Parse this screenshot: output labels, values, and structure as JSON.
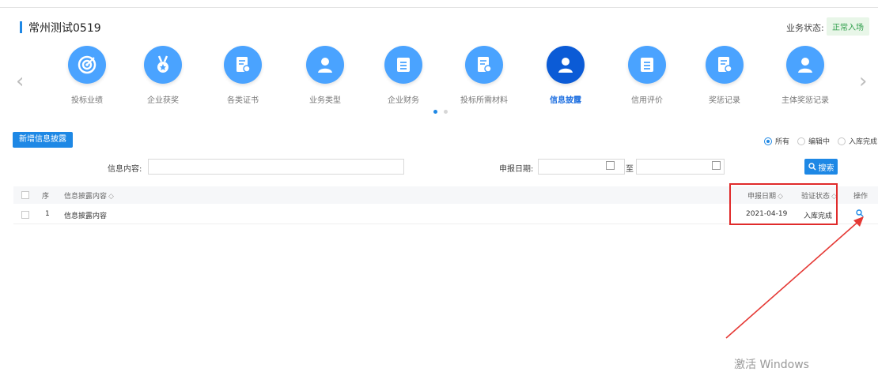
{
  "header": {
    "title": "常州测试0519",
    "status_label": "业务状态:",
    "status_value": "正常入场"
  },
  "carousel": {
    "items": [
      {
        "label": "投标业绩",
        "icon": "target-icon"
      },
      {
        "label": "企业获奖",
        "icon": "medal-icon"
      },
      {
        "label": "各类证书",
        "icon": "certificate-icon"
      },
      {
        "label": "业务类型",
        "icon": "person-icon"
      },
      {
        "label": "企业财务",
        "icon": "list-icon"
      },
      {
        "label": "投标所需材料",
        "icon": "certificate-icon"
      },
      {
        "label": "信息披露",
        "icon": "person-icon",
        "active": true
      },
      {
        "label": "信用评价",
        "icon": "list-icon"
      },
      {
        "label": "奖惩记录",
        "icon": "certificate-icon"
      },
      {
        "label": "主体奖惩记录",
        "icon": "person-icon"
      }
    ],
    "prev": "‹",
    "next": "›",
    "pages": 2,
    "current_page": 1
  },
  "toolbar": {
    "add_label": "新增信息披露",
    "filters": [
      {
        "label": "所有",
        "selected": true
      },
      {
        "label": "编辑中",
        "selected": false
      },
      {
        "label": "入库完成",
        "selected": false
      }
    ]
  },
  "search": {
    "content_label": "信息内容:",
    "content_value": "",
    "date_label": "申报日期:",
    "to_label": "至",
    "date_from": "",
    "date_to": "",
    "button_label": "搜索"
  },
  "table": {
    "columns": [
      "序",
      "信息披露内容",
      "申报日期",
      "验证状态",
      "操作"
    ],
    "rows": [
      {
        "index": "1",
        "content": "信息披露内容",
        "date": "2021-04-19",
        "status": "入库完成"
      }
    ]
  },
  "watermark": "激活 Windows",
  "colors": {
    "primary": "#1e88e5",
    "icon_circle": "#4aa3ff",
    "icon_circle_active": "#0b5bd6",
    "highlight": "#e02b2b",
    "status_badge_bg": "#e8f6e8",
    "status_badge_text": "#2e9e4a"
  }
}
